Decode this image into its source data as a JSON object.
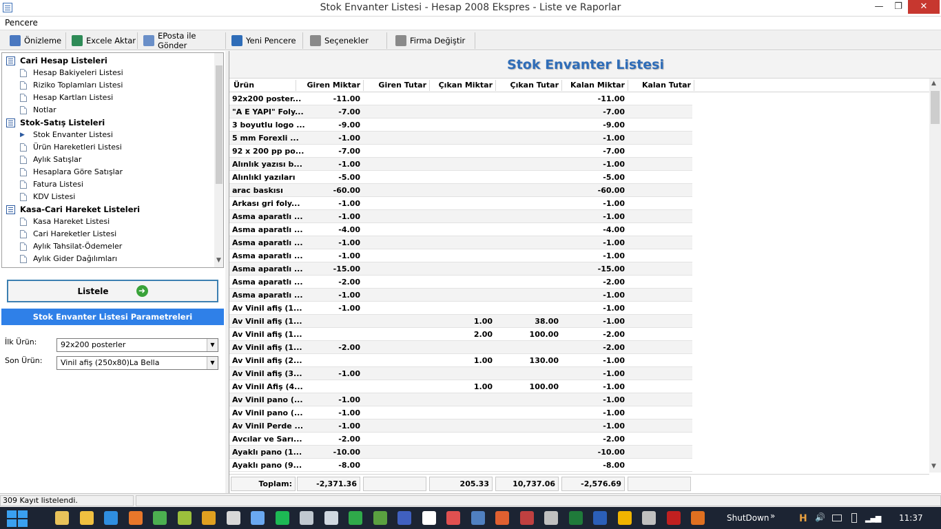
{
  "window": {
    "title": "Stok Envanter Listesi - Hesap 2008 Ekspres - Liste ve Raporlar",
    "minimize": "—",
    "maximize": "❐",
    "close": "✕"
  },
  "menu": {
    "pencere": "Pencere"
  },
  "toolbar": [
    {
      "label": "Önizleme",
      "icon": "preview-icon",
      "color": "#4a78c0"
    },
    {
      "label": "Excele Aktar",
      "icon": "excel-export-icon",
      "color": "#2e8b57"
    },
    {
      "label": "EPosta ile Gönder",
      "icon": "email-icon",
      "color": "#6a8fc8"
    },
    {
      "label": "Yeni Pencere",
      "icon": "new-window-icon",
      "color": "#2f6db8"
    },
    {
      "label": "Seçenekler",
      "icon": "wrench-icon",
      "color": "#8a8a8a"
    },
    {
      "label": "Firma Değiştir",
      "icon": "wrench-icon",
      "color": "#8a8a8a"
    }
  ],
  "tree": {
    "groups": [
      {
        "label": "Cari Hesap Listeleri",
        "items": [
          "Hesap Bakiyeleri Listesi",
          "Riziko Toplamları Listesi",
          "Hesap Kartları Listesi",
          "Notlar"
        ]
      },
      {
        "label": "Stok-Satış Listeleri",
        "items": [
          "Stok Envanter Listesi",
          "Ürün Hareketleri Listesi",
          "Aylık Satışlar",
          "Hesaplara Göre Satışlar",
          "Fatura Listesi",
          "KDV Listesi"
        ]
      },
      {
        "label": "Kasa-Cari Hareket Listeleri",
        "items": [
          "Kasa Hareket Listesi",
          "Cari Hareketler Listesi",
          "Aylık Tahsilat-Ödemeler",
          "Aylık Gider Dağılımları"
        ]
      }
    ],
    "selected": "Stok Envanter Listesi"
  },
  "listele": {
    "label": "Listele"
  },
  "params": {
    "header": "Stok Envanter Listesi Parametreleri",
    "ilk_label": "İlk Ürün:",
    "ilk_value": "92x200 posterler",
    "son_label": "Son Ürün:",
    "son_value": "Vinil afiş (250x80)La Bella"
  },
  "report": {
    "title": "Stok Envanter Listesi",
    "columns": [
      "Ürün",
      "Giren Miktar",
      "Giren Tutar",
      "Çıkan Miktar",
      "Çıkan Tutar",
      "Kalan Miktar",
      "Kalan Tutar"
    ],
    "rows": [
      [
        "92x200 poster...",
        "-11.00",
        "",
        "",
        "",
        "-11.00",
        ""
      ],
      [
        "\"A E YAPI\" Foly...",
        "-7.00",
        "",
        "",
        "",
        "-7.00",
        ""
      ],
      [
        "3 boyutlu logo ...",
        "-9.00",
        "",
        "",
        "",
        "-9.00",
        ""
      ],
      [
        "5 mm Forexli ...",
        "-1.00",
        "",
        "",
        "",
        "-1.00",
        ""
      ],
      [
        "92 x 200 pp po...",
        "-7.00",
        "",
        "",
        "",
        "-7.00",
        ""
      ],
      [
        "Alınlık yazısı b...",
        "-1.00",
        "",
        "",
        "",
        "-1.00",
        ""
      ],
      [
        "Alınlıkl yazıları",
        "-5.00",
        "",
        "",
        "",
        "-5.00",
        ""
      ],
      [
        "arac baskısı",
        "-60.00",
        "",
        "",
        "",
        "-60.00",
        ""
      ],
      [
        "Arkası gri foly...",
        "-1.00",
        "",
        "",
        "",
        "-1.00",
        ""
      ],
      [
        "Asma aparatlı ...",
        "-1.00",
        "",
        "",
        "",
        "-1.00",
        ""
      ],
      [
        "Asma aparatlı ...",
        "-4.00",
        "",
        "",
        "",
        "-4.00",
        ""
      ],
      [
        "Asma aparatlı ...",
        "-1.00",
        "",
        "",
        "",
        "-1.00",
        ""
      ],
      [
        "Asma aparatlı ...",
        "-1.00",
        "",
        "",
        "",
        "-1.00",
        ""
      ],
      [
        "Asma aparatlı ...",
        "-15.00",
        "",
        "",
        "",
        "-15.00",
        ""
      ],
      [
        "Asma aparatlı ...",
        "-2.00",
        "",
        "",
        "",
        "-2.00",
        ""
      ],
      [
        "Asma aparatlı ...",
        "-1.00",
        "",
        "",
        "",
        "-1.00",
        ""
      ],
      [
        "Av Vinil afiş (1...",
        "-1.00",
        "",
        "",
        "",
        "-1.00",
        ""
      ],
      [
        "Av Vinil afiş (1...",
        "",
        "",
        "1.00",
        "38.00",
        "-1.00",
        ""
      ],
      [
        "Av Vinil afiş (1...",
        "",
        "",
        "2.00",
        "100.00",
        "-2.00",
        ""
      ],
      [
        "Av Vinil afiş (1...",
        "-2.00",
        "",
        "",
        "",
        "-2.00",
        ""
      ],
      [
        "Av Vinil afiş (2...",
        "",
        "",
        "1.00",
        "130.00",
        "-1.00",
        ""
      ],
      [
        "Av Vinil afiş (3...",
        "-1.00",
        "",
        "",
        "",
        "-1.00",
        ""
      ],
      [
        "Av Vinil Afiş (4...",
        "",
        "",
        "1.00",
        "100.00",
        "-1.00",
        ""
      ],
      [
        "Av Vinil pano (...",
        "-1.00",
        "",
        "",
        "",
        "-1.00",
        ""
      ],
      [
        "Av Vinil pano (...",
        "-1.00",
        "",
        "",
        "",
        "-1.00",
        ""
      ],
      [
        "Av Vinil Perde ...",
        "-1.00",
        "",
        "",
        "",
        "-1.00",
        ""
      ],
      [
        "Avcılar ve Sarı...",
        "-2.00",
        "",
        "",
        "",
        "-2.00",
        ""
      ],
      [
        "Ayaklı  pano (1...",
        "-10.00",
        "",
        "",
        "",
        "-10.00",
        ""
      ],
      [
        "Ayaklı  pano (9...",
        "-8.00",
        "",
        "",
        "",
        "-8.00",
        ""
      ]
    ],
    "totals": {
      "label": "Toplam:",
      "values": [
        "-2,371.36",
        "",
        "205.33",
        "10,737.06",
        "-2,576.69",
        ""
      ]
    }
  },
  "status": {
    "text": "309 Kayıt listelendi."
  },
  "taskbar": {
    "shutdown": "ShutDown",
    "chevron": "»",
    "clock": "11:37",
    "icons": [
      {
        "name": "explorer-icon",
        "color": "#e8c25a"
      },
      {
        "name": "folder-icon",
        "color": "#f0c040"
      },
      {
        "name": "ie-icon",
        "color": "#2f8ee0"
      },
      {
        "name": "firefox-icon",
        "color": "#e8772a"
      },
      {
        "name": "chrome-icon",
        "color": "#4caf50"
      },
      {
        "name": "bottle-icon",
        "color": "#9bbf3c"
      },
      {
        "name": "media-icon",
        "color": "#e0a020"
      },
      {
        "name": "utility-icon",
        "color": "#d8d8d8"
      },
      {
        "name": "itunes-icon",
        "color": "#6aa8f0"
      },
      {
        "name": "spotify-icon",
        "color": "#1db954"
      },
      {
        "name": "calculator-icon",
        "color": "#c0c8d0"
      },
      {
        "name": "database-icon",
        "color": "#d0d8e0"
      },
      {
        "name": "visual-studio-icon",
        "color": "#2faa4a"
      },
      {
        "name": "hesap-icon",
        "color": "#5aa040"
      },
      {
        "name": "app-icon",
        "color": "#4060c0"
      },
      {
        "name": "star-icon",
        "color": "#ffffff"
      },
      {
        "name": "paint-icon",
        "color": "#e05050"
      },
      {
        "name": "report-icon",
        "color": "#5080c0"
      },
      {
        "name": "office-icon",
        "color": "#e06030"
      },
      {
        "name": "tool-icon",
        "color": "#c04040"
      },
      {
        "name": "settings-icon",
        "color": "#c0c0c0"
      },
      {
        "name": "excel-icon",
        "color": "#1f7a3a"
      },
      {
        "name": "word-icon",
        "color": "#2b5fb8"
      },
      {
        "name": "outlook-icon",
        "color": "#f0b400"
      },
      {
        "name": "remote-icon",
        "color": "#c0c0c0"
      },
      {
        "name": "filezilla-icon",
        "color": "#c02020"
      },
      {
        "name": "h-app-icon",
        "color": "#e07020"
      }
    ]
  }
}
